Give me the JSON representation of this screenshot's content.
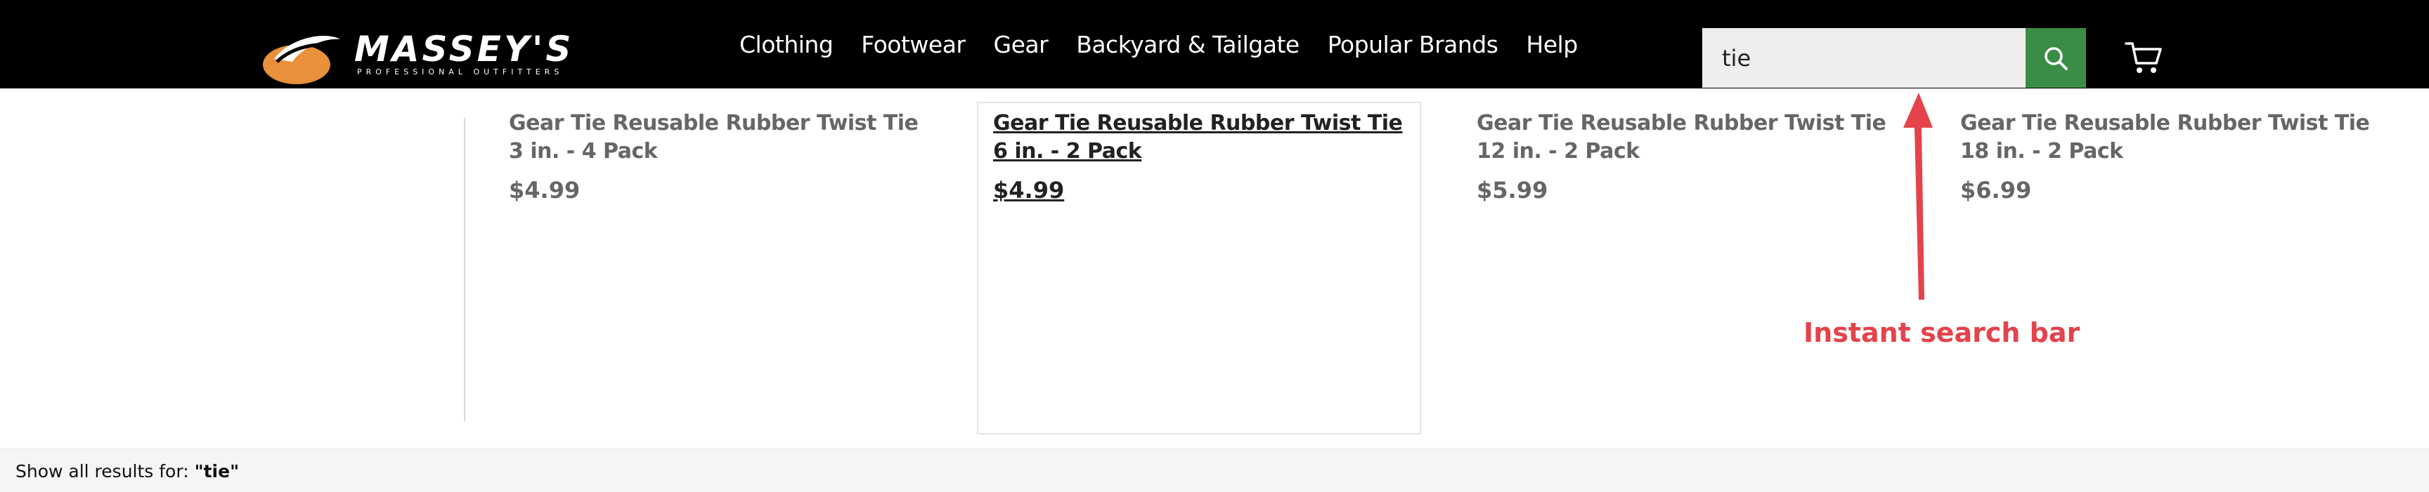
{
  "brand": {
    "name": "MASSEY'S",
    "tagline": "PROFESSIONAL OUTFITTERS",
    "logo_icon": "massey-swoosh-logo",
    "logo_color": "#e8903a"
  },
  "nav": {
    "items": [
      {
        "label": "Clothing"
      },
      {
        "label": "Footwear"
      },
      {
        "label": "Gear"
      },
      {
        "label": "Backyard & Tailgate"
      },
      {
        "label": "Popular Brands"
      },
      {
        "label": "Help"
      }
    ]
  },
  "search": {
    "value": "tie",
    "button_icon": "search-icon",
    "button_color": "#3a8d45"
  },
  "cart": {
    "icon": "cart-icon"
  },
  "results": [
    {
      "name": "Gear Tie Reusable Rubber Twist Tie 3 in. - 4 Pack",
      "price": "$4.99",
      "active": false
    },
    {
      "name": "Gear Tie Reusable Rubber Twist Tie 6 in. - 2 Pack",
      "price": "$4.99",
      "active": true
    },
    {
      "name": "Gear Tie Reusable Rubber Twist Tie 12 in. - 2 Pack",
      "price": "$5.99",
      "active": false
    },
    {
      "name": "Gear Tie Reusable Rubber Twist Tie 18 in. - 2 Pack",
      "price": "$6.99",
      "active": false
    }
  ],
  "annotation": {
    "label": "Instant search bar",
    "color": "#e4434b"
  },
  "footer": {
    "prefix": "Show all results for: ",
    "query": "\"tie\""
  }
}
